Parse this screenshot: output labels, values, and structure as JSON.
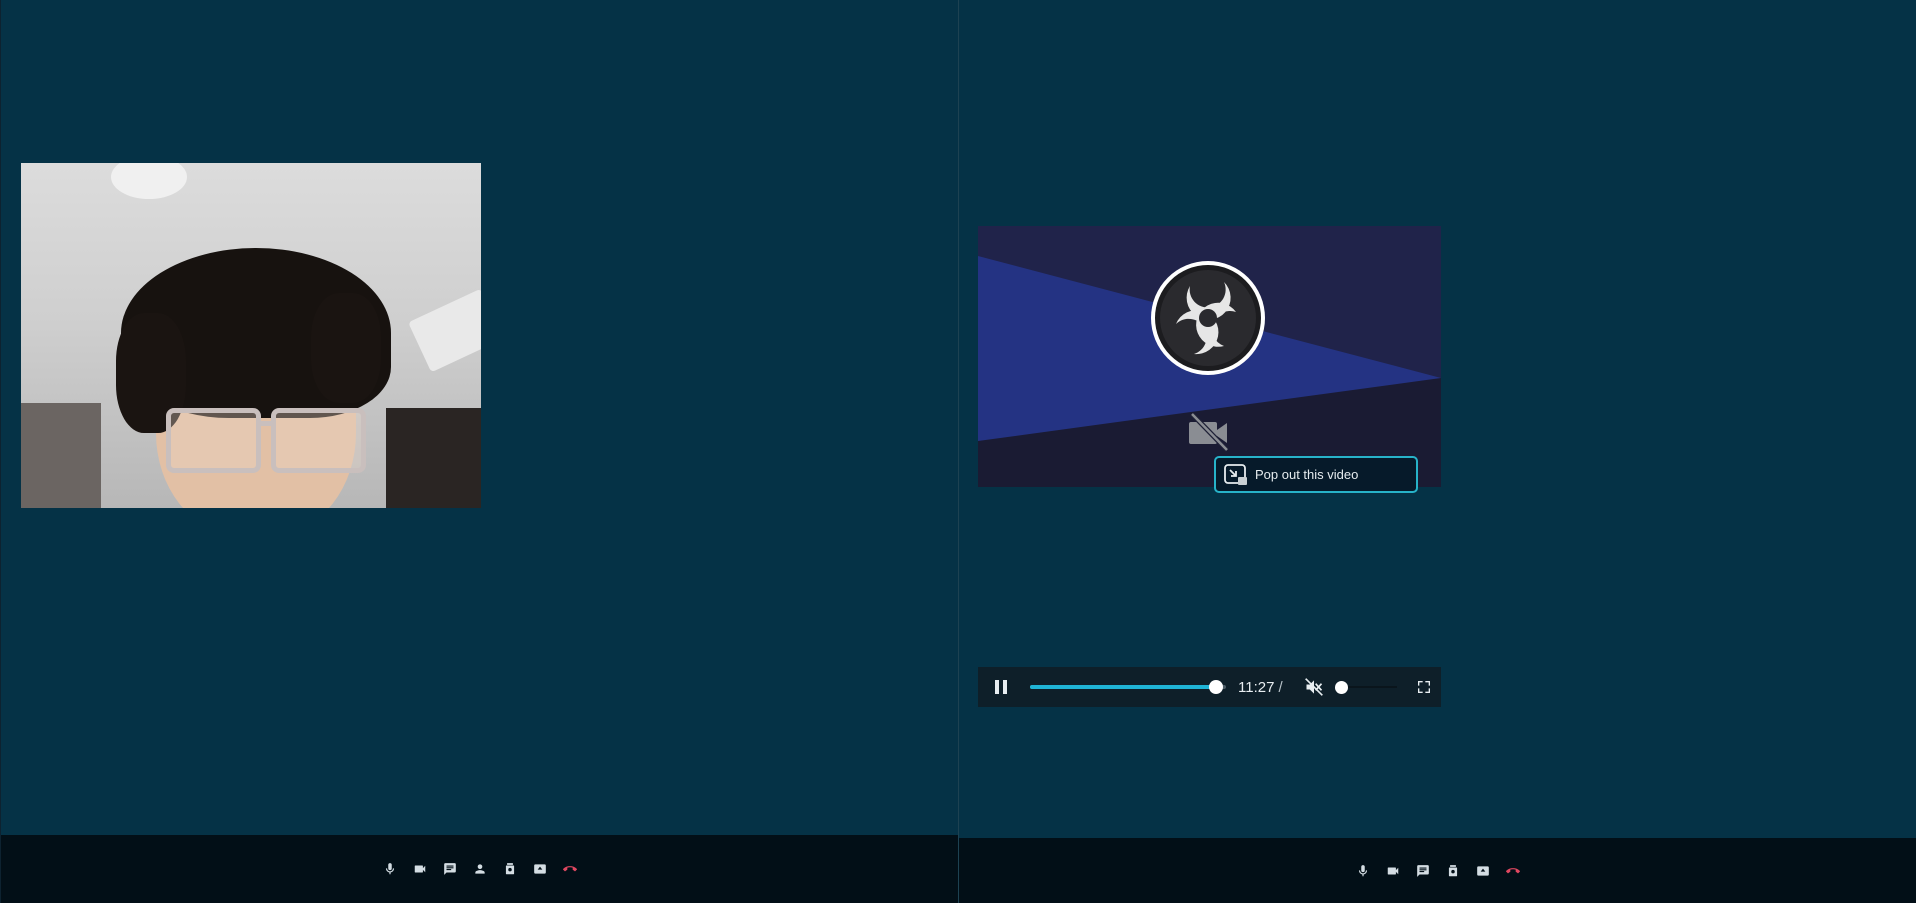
{
  "left_call": {
    "toolbar": {
      "buttons": [
        {
          "name": "microphone",
          "icon": "mic-icon"
        },
        {
          "name": "camera",
          "icon": "camera-icon"
        },
        {
          "name": "chat",
          "icon": "chat-icon"
        },
        {
          "name": "participants",
          "icon": "person-icon"
        },
        {
          "name": "record",
          "icon": "record-icon"
        },
        {
          "name": "share-screen",
          "icon": "screen-share-icon"
        },
        {
          "name": "hang-up",
          "icon": "hangup-icon",
          "color": "#e04760"
        }
      ]
    }
  },
  "right_call": {
    "shared_screen": {
      "background_colors": [
        "#20234a",
        "#243383",
        "#1a1b33"
      ],
      "logo": "obs-logo",
      "overlay_icon": "camera-off-icon"
    },
    "tooltip": {
      "label": "Pop out this video",
      "icon": "pop-out-icon",
      "border_color": "#27b3c9"
    },
    "media_controls": {
      "state": "playing",
      "play_pause_icon": "pause-icon",
      "current_time": "11:27",
      "time_separator": "/",
      "progress": 0.95,
      "muted": true,
      "volume": 0.0,
      "accent_color": "#1fb4d6"
    },
    "toolbar": {
      "buttons": [
        {
          "name": "microphone",
          "icon": "mic-icon"
        },
        {
          "name": "camera",
          "icon": "camera-icon"
        },
        {
          "name": "chat",
          "icon": "chat-icon"
        },
        {
          "name": "record",
          "icon": "record-icon"
        },
        {
          "name": "share-screen",
          "icon": "screen-share-icon"
        },
        {
          "name": "hang-up",
          "icon": "hangup-icon",
          "color": "#e04760"
        }
      ]
    }
  },
  "colors": {
    "background": "#053246",
    "toolbar_background": "#020f17",
    "hangup": "#e04760"
  }
}
